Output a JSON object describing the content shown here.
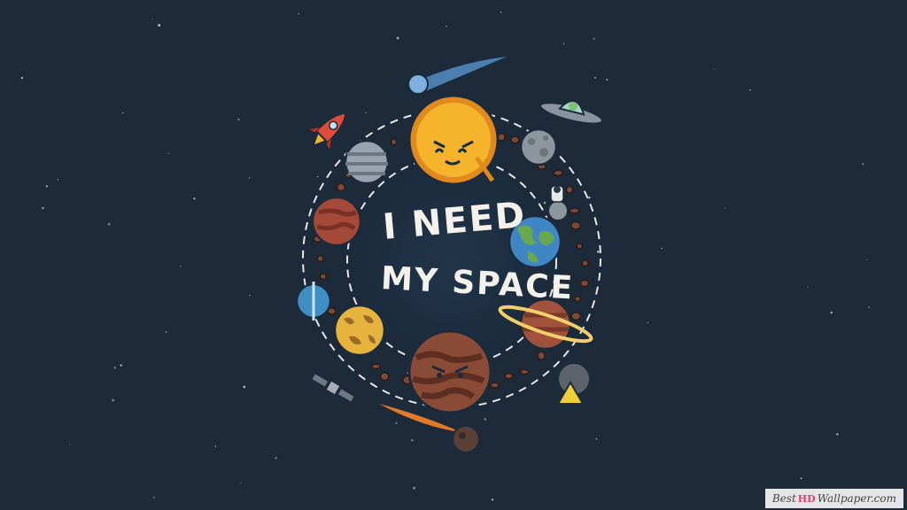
{
  "colors": {
    "background": "#1d2a3a",
    "sun": "#f6b32c",
    "text": "#f4f1ea"
  },
  "slogan": {
    "line1": "I NEED",
    "line2": "MY SPACE"
  },
  "watermark": {
    "prefix": "Best",
    "mark": "HD",
    "suffix": "Wallpaper.com"
  }
}
